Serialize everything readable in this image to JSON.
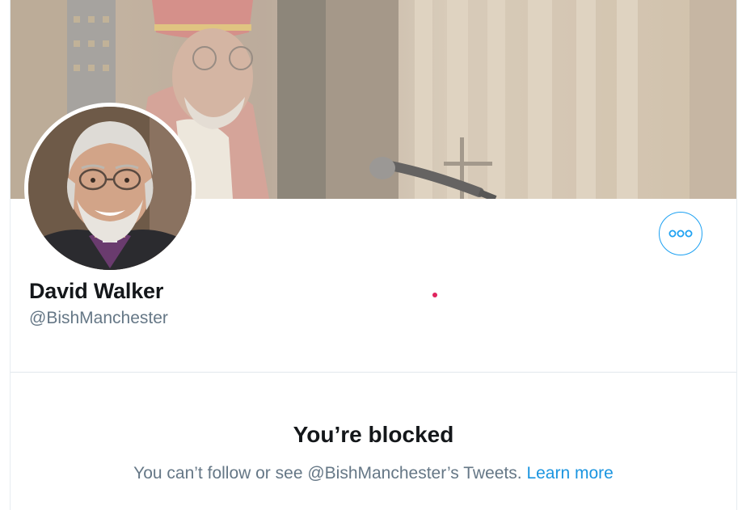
{
  "profile": {
    "name": "David Walker",
    "handle": "@BishManchester"
  },
  "blocked": {
    "title": "You’re blocked",
    "description": "You can’t follow or see @BishManchester’s Tweets.",
    "learn_more_label": "Learn more"
  },
  "icons": {
    "more": "more-horizontal-icon"
  },
  "colors": {
    "accent": "#1da1f2",
    "link": "#1b95e0",
    "text_primary": "#14171a",
    "text_secondary": "#657786",
    "indicator": "#e0245e"
  }
}
